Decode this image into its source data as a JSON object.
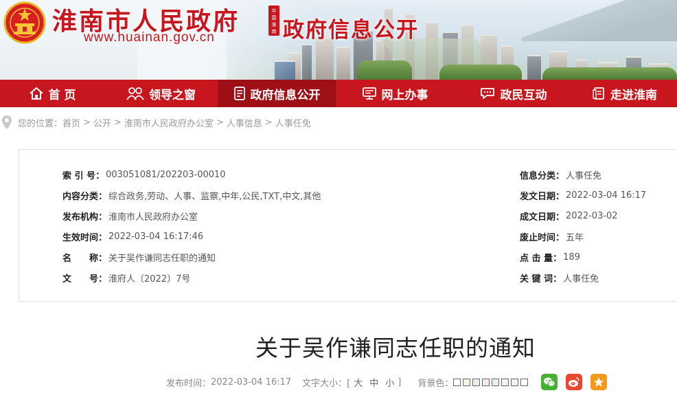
{
  "header": {
    "site_title": "淮南市人民政府",
    "site_url": "www.huainan.gov.cn",
    "seal_text": "中国淮南",
    "section_title": "政府信息公开"
  },
  "nav": {
    "items": [
      {
        "label": "首 页",
        "icon": "home-icon"
      },
      {
        "label": "领导之窗",
        "icon": "people-icon"
      },
      {
        "label": "政府信息公开",
        "icon": "document-icon",
        "active": true
      },
      {
        "label": "网上办事",
        "icon": "monitor-icon"
      },
      {
        "label": "政民互动",
        "icon": "chat-icon"
      },
      {
        "label": "走进淮南",
        "icon": "book-icon"
      }
    ]
  },
  "breadcrumb": {
    "prefix": "您的位置：",
    "items": [
      "首页",
      "公开",
      "淮南市人民政府办公室",
      "人事信息",
      "人事任免"
    ],
    "separator": ">"
  },
  "meta": {
    "left": [
      {
        "label": "索 引 号",
        "value": "003051081/202203-00010"
      },
      {
        "label": "内容分类",
        "value": "综合政务,劳动、人事、监察,中年,公民,TXT,中文,其他"
      },
      {
        "label": "发布机构",
        "value": "淮南市人民政府办公室"
      },
      {
        "label": "生效时间",
        "value": "2022-03-04 16:17:46"
      },
      {
        "label": "名　　称",
        "value": "关于吴作谦同志任职的通知"
      },
      {
        "label": "文　　号",
        "value": "淮府人〔2022〕7号"
      }
    ],
    "right": [
      {
        "label": "信息分类",
        "value": "人事任免"
      },
      {
        "label": "发文日期",
        "value": "2022-03-04 16:17"
      },
      {
        "label": "成文日期",
        "value": "2022-03-02"
      },
      {
        "label": "废止时间",
        "value": "五年"
      },
      {
        "label": "点 击 量",
        "value": "189"
      },
      {
        "label": "关 键 词",
        "value": "人事任免"
      }
    ]
  },
  "article": {
    "title": "关于吴作谦同志任职的通知",
    "publish_label": "发布时间：",
    "publish_time": "2022-03-04 16:17",
    "font_size_label": "文字大小：[",
    "font_sizes": [
      "大",
      "中",
      "小"
    ],
    "font_size_close": "]",
    "bg_label": "背景色：",
    "bg_colors": [
      "#ffffff",
      "#f5f5e5",
      "#ececec",
      "#f9e9e9",
      "#e7f3e7",
      "#eef7ee",
      "#f0f4fb",
      "#ffffff"
    ],
    "share": [
      {
        "name": "wechat",
        "color": "#46b134"
      },
      {
        "name": "weibo",
        "color": "#e9472e"
      },
      {
        "name": "favorite",
        "color": "#f39a1c"
      }
    ]
  }
}
